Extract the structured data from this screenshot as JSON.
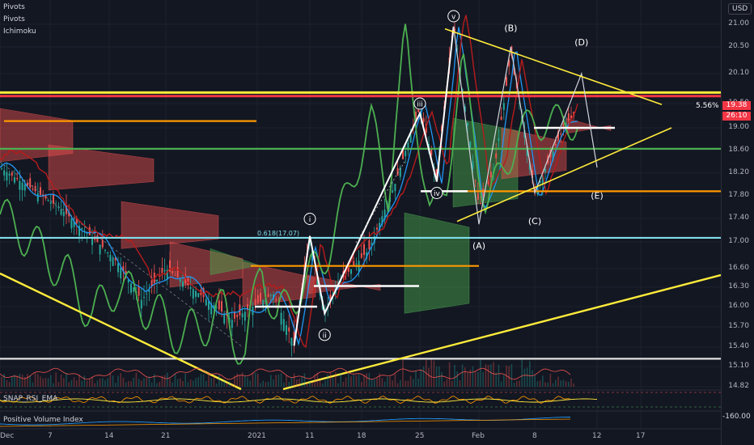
{
  "legend": {
    "line1": "Pivots",
    "line2": "Pivots",
    "line3": "Ichimoku"
  },
  "panes": {
    "rsi_label": "SNAP_RSI_EMA",
    "pvi_label": "Positive Volume Index"
  },
  "price_axis": {
    "currency": "USD",
    "ticks": [
      "21.00",
      "20.50",
      "20.10",
      "19.50",
      "19.00",
      "18.60",
      "18.20",
      "17.80",
      "17.40",
      "17.00",
      "16.60",
      "16.30",
      "16.00",
      "15.70",
      "15.40",
      "15.10",
      "14.82"
    ],
    "last_price": "19.38",
    "change_pct": "5.56%",
    "countdown": "26:10"
  },
  "rsi_axis": {
    "value": "-160.00"
  },
  "time_axis": {
    "ticks": [
      "Dec",
      "7",
      "14",
      "21",
      "2021",
      "11",
      "18",
      "25",
      "Feb",
      "8",
      "12",
      "17"
    ]
  },
  "wave_labels": [
    "i",
    "ii",
    "iii",
    "iv",
    "v",
    "(A)",
    "(B)",
    "(C)",
    "(D)",
    "(E)"
  ],
  "fib_label": "0.618(17.07)",
  "colors": {
    "up": "#26a69a",
    "down": "#ef5350",
    "yellow": "#ffeb3b",
    "orange": "#ff9800",
    "green": "#4caf50"
  },
  "chart_data": {
    "type": "line",
    "symbol_price_range": [
      14.82,
      21.0
    ],
    "price_levels": [
      {
        "price": 19.72,
        "color": "yellow"
      },
      {
        "price": 19.65,
        "color": "red"
      },
      {
        "price": 19.14,
        "color": "orange"
      },
      {
        "price": 18.63,
        "color": "green"
      },
      {
        "price": 17.88,
        "color": "orange"
      },
      {
        "price": 17.07,
        "color": "cyan"
      },
      {
        "price": 16.64,
        "color": "orange"
      },
      {
        "price": 15.22,
        "color": "white"
      }
    ],
    "close_path": [
      {
        "x": "Dec 1",
        "y": 18.3
      },
      {
        "x": "Dec 4",
        "y": 18.0
      },
      {
        "x": "Dec 8",
        "y": 17.6
      },
      {
        "x": "Dec 11",
        "y": 17.2
      },
      {
        "x": "Dec 15",
        "y": 16.7
      },
      {
        "x": "Dec 18",
        "y": 16.1
      },
      {
        "x": "Dec 21",
        "y": 16.6
      },
      {
        "x": "Dec 24",
        "y": 16.3
      },
      {
        "x": "Dec 29",
        "y": 15.8
      },
      {
        "x": "Jan 4",
        "y": 16.2
      },
      {
        "x": "Jan 8",
        "y": 15.45
      },
      {
        "x": "Jan 11",
        "y": 17.05
      },
      {
        "x": "Jan 13",
        "y": 15.95
      },
      {
        "x": "Jan 15",
        "y": 16.4
      },
      {
        "x": "Jan 19",
        "y": 16.9
      },
      {
        "x": "Jan 22",
        "y": 18.0
      },
      {
        "x": "Jan 25",
        "y": 19.4
      },
      {
        "x": "Jan 27",
        "y": 18.1
      },
      {
        "x": "Jan 29",
        "y": 20.95
      },
      {
        "x": "Feb 1",
        "y": 17.6
      },
      {
        "x": "Feb 3",
        "y": 18.3
      },
      {
        "x": "Feb 5",
        "y": 20.45
      },
      {
        "x": "Feb 8",
        "y": 17.85
      },
      {
        "x": "Feb 10",
        "y": 19.1
      },
      {
        "x": "Feb 11",
        "y": 19.38
      }
    ],
    "wave_points": [
      {
        "label": "i",
        "x": "Jan 11",
        "y": 17.2
      },
      {
        "label": "ii",
        "x": "Jan 13",
        "y": 15.75
      },
      {
        "label": "iii",
        "x": "Jan 25",
        "y": 19.5
      },
      {
        "label": "iv",
        "x": "Jan 27",
        "y": 17.85
      },
      {
        "label": "v",
        "x": "Jan 29",
        "y": 21.0
      },
      {
        "label": "(A)",
        "x": "Feb 1",
        "y": 17.07
      },
      {
        "label": "(B)",
        "x": "Feb 5",
        "y": 20.7
      },
      {
        "label": "(C)",
        "x": "Feb 8",
        "y": 17.55
      },
      {
        "label": "(D)",
        "x": "Feb 11",
        "y": 20.4
      },
      {
        "label": "(E)",
        "x": "Feb 12",
        "y": 18.0
      }
    ]
  }
}
